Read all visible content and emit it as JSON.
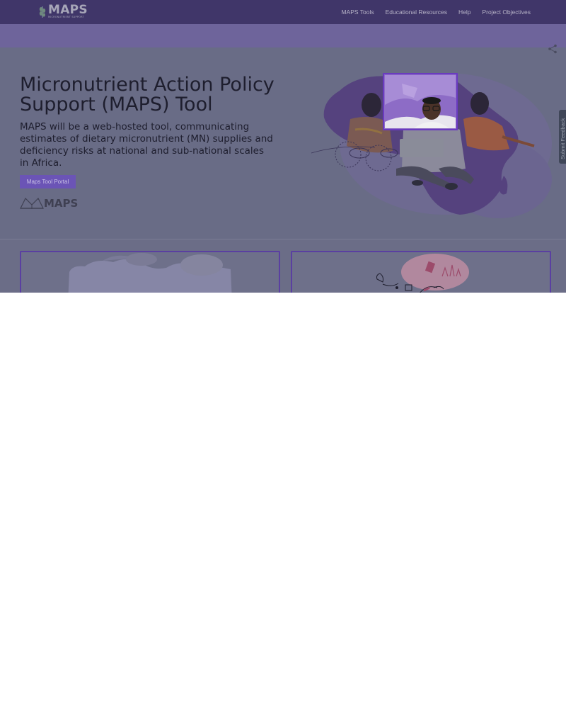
{
  "brand": {
    "logo_text": "MAPS",
    "logo_subtext": "MICRONUTRIENT SUPPORT"
  },
  "nav": {
    "items": [
      "MAPS Tools",
      "Educational Resources",
      "Help",
      "Project Objectives"
    ]
  },
  "hero": {
    "title": "Micronutrient Action Policy Support (MAPS) Tool",
    "description": "MAPS will be a web-hosted tool, communicating estimates of dietary micronutrient (MN) supplies and deficiency risks at national and sub-national scales in Africa.",
    "cta_label": "Maps Tool Portal",
    "partner_logo_text": "MAPS"
  },
  "feedback": {
    "label": "Submit Feedback"
  },
  "icons": {
    "share": "share-icon",
    "logo": "maps-logo-icon"
  },
  "colors": {
    "header": "#403669",
    "subbar": "#6e649b",
    "accent": "#6b54b6",
    "card_border": "#5a3fa1"
  }
}
